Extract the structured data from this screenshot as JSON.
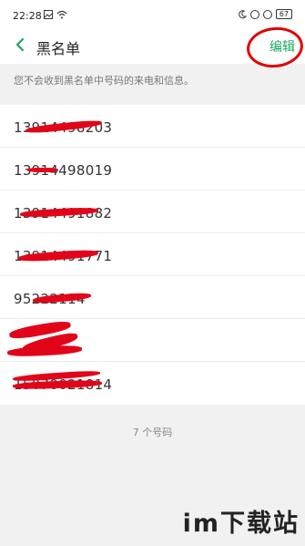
{
  "status": {
    "time": "22:28",
    "battery": "67"
  },
  "header": {
    "title": "黑名单",
    "edit_label": "编辑"
  },
  "notice": "您不会收到黑名单中号码的来电和信息。",
  "numbers": [
    {
      "text": "13914498203"
    },
    {
      "text": "13914498019"
    },
    {
      "text": "13914491882"
    },
    {
      "text": "13914491771"
    },
    {
      "text": "95222114"
    },
    {
      "text": ""
    },
    {
      "text": "15070021814"
    }
  ],
  "count": "7 个号码",
  "watermark": "im下载站",
  "colors": {
    "accent": "#1aa85b",
    "annotation_red": "#e20000"
  }
}
